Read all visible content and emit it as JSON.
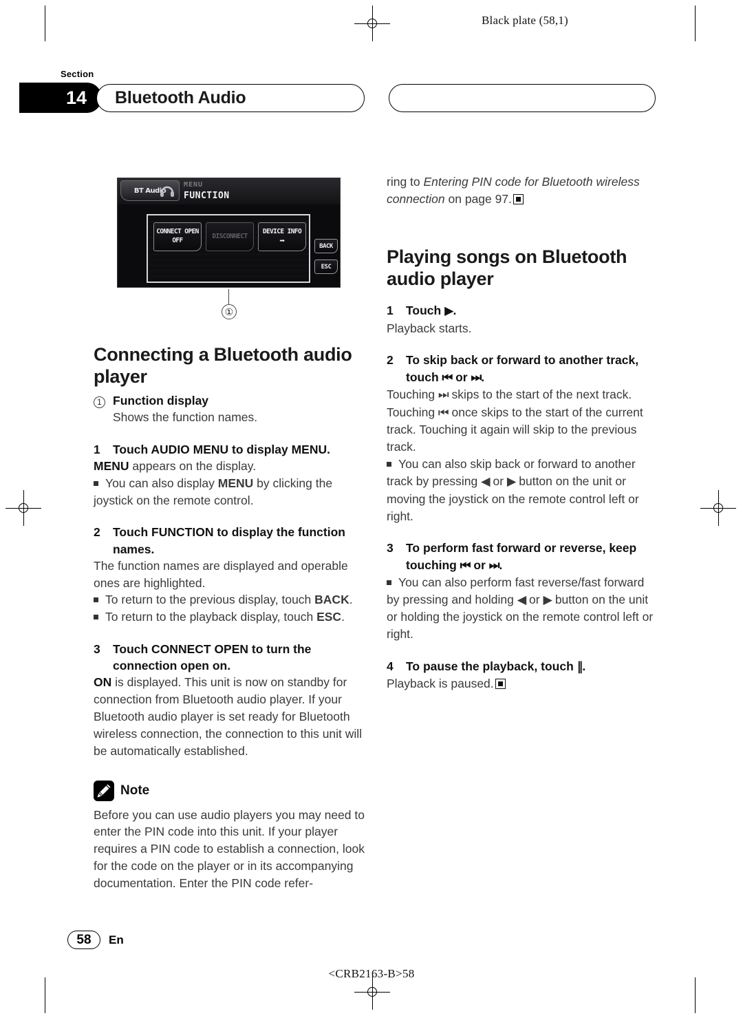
{
  "print_marks": {
    "black_plate": "Black plate (58,1)",
    "doc_code": "<CRB2163-B>58"
  },
  "header": {
    "section_word": "Section",
    "section_number": "14",
    "title": "Bluetooth Audio"
  },
  "device_screenshot": {
    "source_tab": "BT Audio",
    "menu_label": "MENU",
    "mode_label": "FUNCTION",
    "buttons": [
      {
        "line1": "CONNECT OPEN",
        "line2": "OFF",
        "state": "active"
      },
      {
        "line1": "DISCONNECT",
        "line2": "",
        "state": "dimmed"
      },
      {
        "line1": "DEVICE INFO",
        "line2": "➡",
        "state": "active"
      }
    ],
    "side_buttons": [
      "BACK",
      "ESC"
    ],
    "callout_number": "①"
  },
  "left_column": {
    "heading": "Connecting a Bluetooth audio player",
    "callout": {
      "marker": "1",
      "title": "Function display",
      "description": "Shows the function names."
    },
    "step1": {
      "num": "1",
      "title": "Touch AUDIO MENU to display MENU.",
      "body_bold": "MENU",
      "body_rest": " appears on the display.",
      "bullet_pre": "You can also display ",
      "bullet_bold": "MENU",
      "bullet_post": " by clicking the joystick on the remote control."
    },
    "step2": {
      "num": "2",
      "title": "Touch FUNCTION to display the function names.",
      "body": "The function names are displayed and operable ones are highlighted.",
      "bullet1_pre": "To return to the previous display, touch ",
      "bullet1_bold": "BACK",
      "bullet1_post": ".",
      "bullet2_pre": "To return to the playback display, touch ",
      "bullet2_bold": "ESC",
      "bullet2_post": "."
    },
    "step3": {
      "num": "3",
      "title": "Touch CONNECT OPEN to turn the connection open on.",
      "body_bold": "ON",
      "body_rest": " is displayed. This unit is now on standby for connection from Bluetooth audio player. If your Bluetooth audio player is set ready for Bluetooth wireless connection, the connection to this unit will be automatically established."
    },
    "note": {
      "label": "Note",
      "text": "Before you can use audio players you may need to enter the PIN code into this unit. If your player requires a PIN code to establish a connection, look for the code on the player or in its accompanying documentation. Enter the PIN code refer-"
    }
  },
  "right_column": {
    "note_continued": {
      "pre": "ring to ",
      "italic": "Entering PIN code for Bluetooth wireless connection",
      "post": " on page 97."
    },
    "heading": "Playing songs on Bluetooth audio player",
    "step1": {
      "num": "1",
      "title_pre": "Touch ",
      "title_glyph": "▶",
      "title_post": ".",
      "body": "Playback starts."
    },
    "step2": {
      "num": "2",
      "title_pre": "To skip back or forward to another track, touch ",
      "title_glyph_prev": "⏮",
      "title_mid": " or ",
      "title_glyph_next": "⏭",
      "title_post": ".",
      "body_a": "Touching ",
      "body_glyph_next": "⏭",
      "body_b": " skips to the start of the next track. Touching ",
      "body_glyph_prev": "⏮",
      "body_c": " once skips to the start of the current track. Touching it again will skip to the previous track.",
      "bullet_a": "You can also skip back or forward to another track by pressing ",
      "bullet_glyph_left": "◀",
      "bullet_b": " or ",
      "bullet_glyph_right": "▶",
      "bullet_c": " button on the unit or moving the joystick on the remote control left or right."
    },
    "step3": {
      "num": "3",
      "title_pre": "To perform fast forward or reverse, keep touching ",
      "title_glyph_prev": "⏮",
      "title_mid": " or ",
      "title_glyph_next": "⏭",
      "title_post": ".",
      "bullet_a": "You can also perform fast reverse/fast forward by pressing and holding ",
      "bullet_glyph_left": "◀",
      "bullet_b": " or ",
      "bullet_glyph_right": "▶",
      "bullet_c": " button on the unit or holding the joystick on the remote control left or right."
    },
    "step4": {
      "num": "4",
      "title_pre": "To pause the playback, touch ",
      "title_glyph": "‖",
      "title_post": ".",
      "body": "Playback is paused."
    }
  },
  "footer": {
    "page_number": "58",
    "language": "En"
  }
}
